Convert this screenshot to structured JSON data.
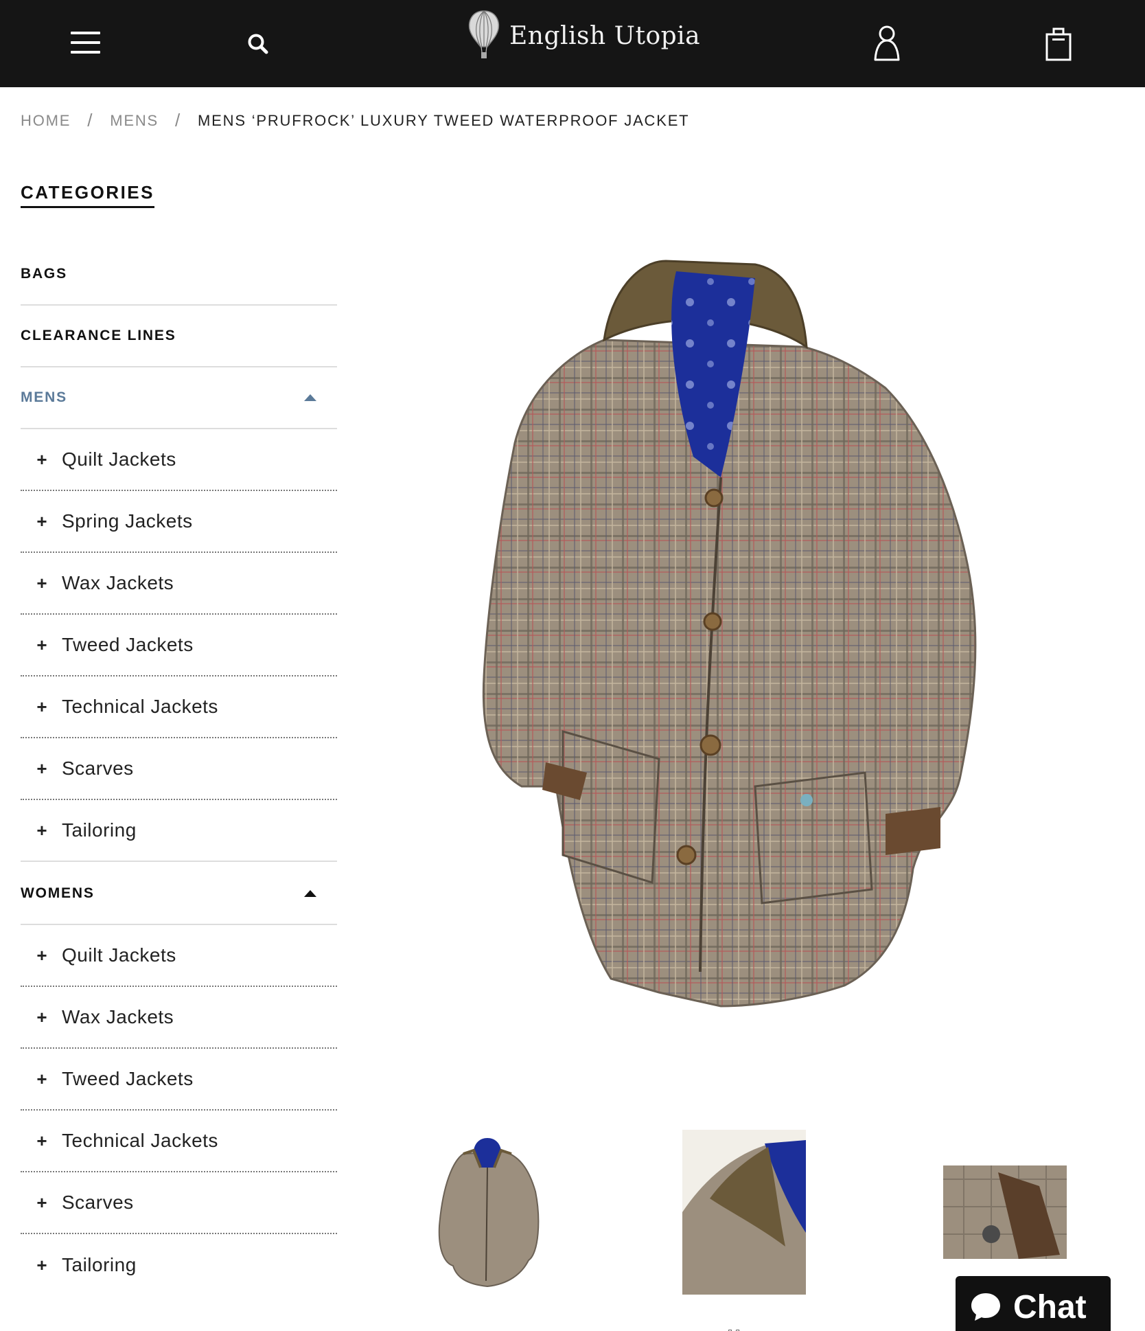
{
  "header": {
    "menu_icon": "hamburger-menu-icon",
    "search_icon": "search-icon",
    "logo_icon": "hot-air-balloon-icon",
    "logo_text": "English Utopia",
    "account_icon": "user-account-icon",
    "bag_icon": "shopping-bag-icon",
    "background_color": "#151515"
  },
  "breadcrumb": {
    "home": "HOME",
    "mens": "MENS",
    "separator": "/",
    "current": "MENS ‘PRUFROCK’ LUXURY TWEED WATERPROOF JACKET"
  },
  "sidebar": {
    "heading": "CATEGORIES",
    "categories": [
      {
        "label": "BAGS"
      },
      {
        "label": "CLEARANCE LINES"
      },
      {
        "label": "MENS",
        "expanded": true,
        "active": true,
        "subs": [
          "Quilt Jackets",
          "Spring Jackets",
          "Wax Jackets",
          "Tweed Jackets",
          "Technical Jackets",
          "Scarves",
          "Tailoring"
        ]
      },
      {
        "label": "WOMENS",
        "expanded": true,
        "subs": [
          "Quilt Jackets",
          "Wax Jackets",
          "Tweed Jackets",
          "Technical Jackets",
          "Scarves",
          "Tailoring"
        ]
      }
    ],
    "plus_symbol": "+",
    "active_color": "#5b7a99"
  },
  "product": {
    "main_image": "tweed-jacket-photo",
    "thumbnails": [
      "jacket-full-thumbnail",
      "jacket-collar-thumbnail",
      "jacket-pocket-thumbnail"
    ],
    "carousel_dots": "▫▫"
  },
  "chat": {
    "label": "Chat",
    "icon": "chat-bubble-icon"
  }
}
